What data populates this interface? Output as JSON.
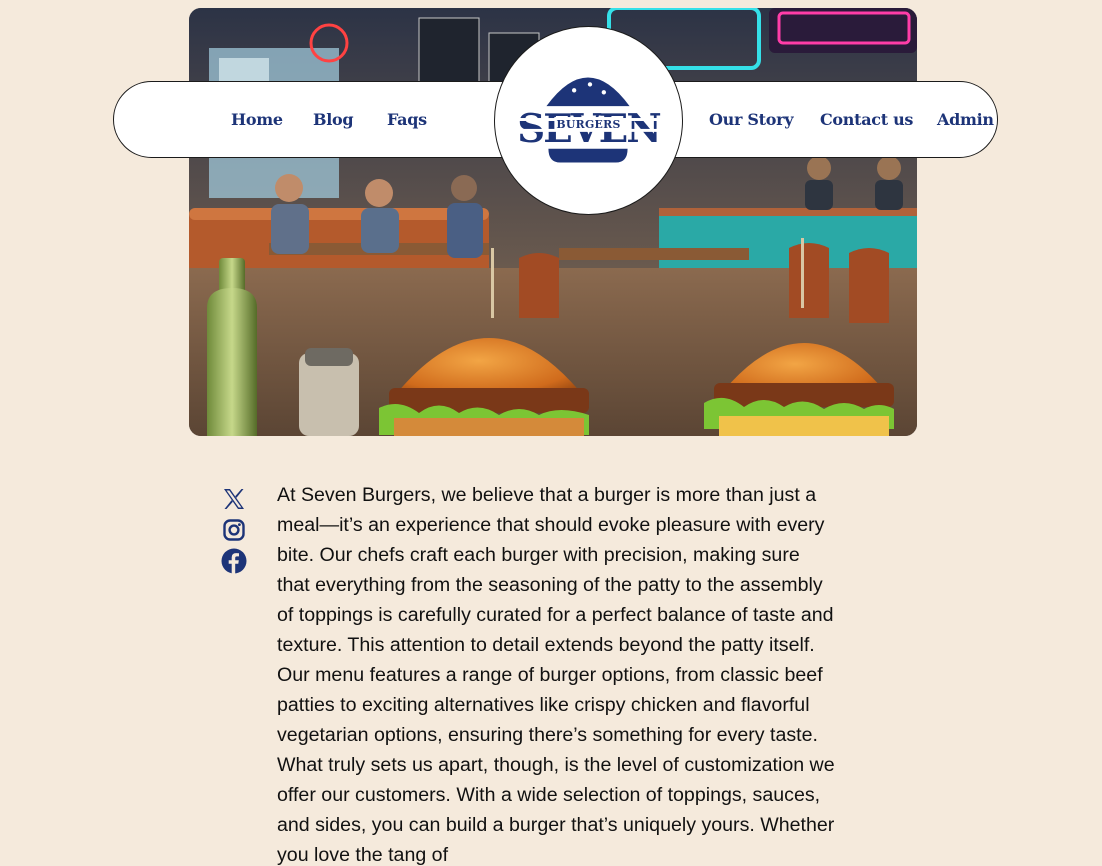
{
  "nav": {
    "left_links": [
      {
        "label": "Home"
      },
      {
        "label": "Blog"
      },
      {
        "label": "Faqs"
      }
    ],
    "right_links": [
      {
        "label": "Our Story"
      },
      {
        "label": "Contact us"
      },
      {
        "label": "Admin"
      }
    ]
  },
  "logo": {
    "brand_word": "SEVEN",
    "sub_word": "BURGERS"
  },
  "social": [
    {
      "icon": "x-twitter-icon"
    },
    {
      "icon": "instagram-icon"
    },
    {
      "icon": "facebook-icon"
    }
  ],
  "article": {
    "paragraph": "At Seven Burgers, we believe that a burger is more than just a meal—it’s an experience that should evoke pleasure with every bite. Our chefs craft each burger with precision, making sure that everything from the seasoning of the patty to the assembly of toppings is carefully curated for a perfect balance of taste and texture. This attention to detail extends beyond the patty itself. Our menu features a range of burger options, from classic beef patties to exciting alternatives like crispy chicken and flavorful vegetarian options, ensuring there’s something for every taste. What truly sets us apart, though, is the level of customization we offer our customers. With a wide selection of toppings, sauces, and sides, you can build a burger that’s uniquely yours. Whether you love the tang of"
  },
  "colors": {
    "background": "#f5eadc",
    "brand_blue": "#1d3478",
    "nav_bg": "#ffffff",
    "text": "#111111"
  }
}
